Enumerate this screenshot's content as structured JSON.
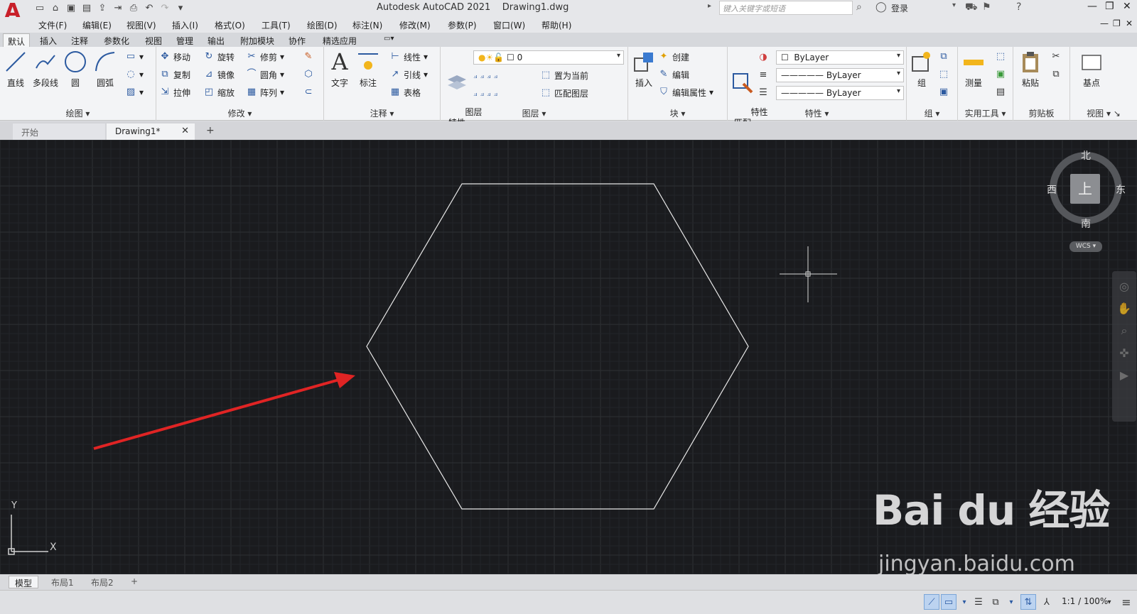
{
  "app": {
    "title": "Autodesk AutoCAD 2021    Drawing1.dwg",
    "search_placeholder": "键入关键字或短语",
    "login": "登录"
  },
  "menus": [
    "文件(F)",
    "编辑(E)",
    "视图(V)",
    "插入(I)",
    "格式(O)",
    "工具(T)",
    "绘图(D)",
    "标注(N)",
    "修改(M)",
    "参数(P)",
    "窗口(W)",
    "帮助(H)"
  ],
  "ribbon_tabs": [
    "默认",
    "插入",
    "注释",
    "参数化",
    "视图",
    "管理",
    "输出",
    "附加模块",
    "协作",
    "精选应用"
  ],
  "ribbon": {
    "draw": {
      "title": "绘图",
      "line": "直线",
      "polyline": "多段线",
      "circle": "圆",
      "arc": "圆弧"
    },
    "modify": {
      "title": "修改",
      "move": "移动",
      "rotate": "旋转",
      "trim": "修剪",
      "copy": "复制",
      "mirror": "镜像",
      "fillet": "圆角",
      "stretch": "拉伸",
      "scale": "缩放",
      "array": "阵列"
    },
    "annotation": {
      "title": "注释",
      "text": "文字",
      "dimension": "标注",
      "linear": "线性",
      "leader": "引线",
      "table": "表格"
    },
    "layers": {
      "title": "图层",
      "properties": "图层\n特性",
      "current_layer": "0",
      "set_current": "置为当前",
      "match_layer": "匹配图层"
    },
    "block": {
      "title": "块",
      "insert": "插入",
      "create": "创建",
      "edit": "编辑",
      "edit_attr": "编辑属性"
    },
    "properties": {
      "title": "特性",
      "match": "特性\n匹配",
      "color": "ByLayer",
      "linetype": "ByLayer",
      "lineweight": "ByLayer"
    },
    "groups": {
      "title": "组",
      "group": "组"
    },
    "utilities": {
      "title": "实用工具",
      "measure": "测量"
    },
    "clipboard": {
      "title": "剪贴板",
      "paste": "粘贴"
    },
    "view": {
      "title": "视图",
      "basepoint": "基点"
    }
  },
  "file_tabs": {
    "start": "开始",
    "drawing": "Drawing1*"
  },
  "viewcube": {
    "north": "北",
    "south": "南",
    "east": "东",
    "west": "西",
    "top": "上",
    "wcs": "WCS"
  },
  "ucs": {
    "x": "X",
    "y": "Y"
  },
  "watermark": {
    "brand": "Bai du 经验",
    "url": "jingyan.baidu.com"
  },
  "layout_tabs": [
    "模型",
    "布局1",
    "布局2"
  ],
  "status": {
    "scale": "1:1 / 100%"
  },
  "colors": {
    "canvas": "#1a1b1e",
    "hexagon": "#e8e8e8",
    "arrow": "#e02424",
    "logo": "#c8202a"
  }
}
